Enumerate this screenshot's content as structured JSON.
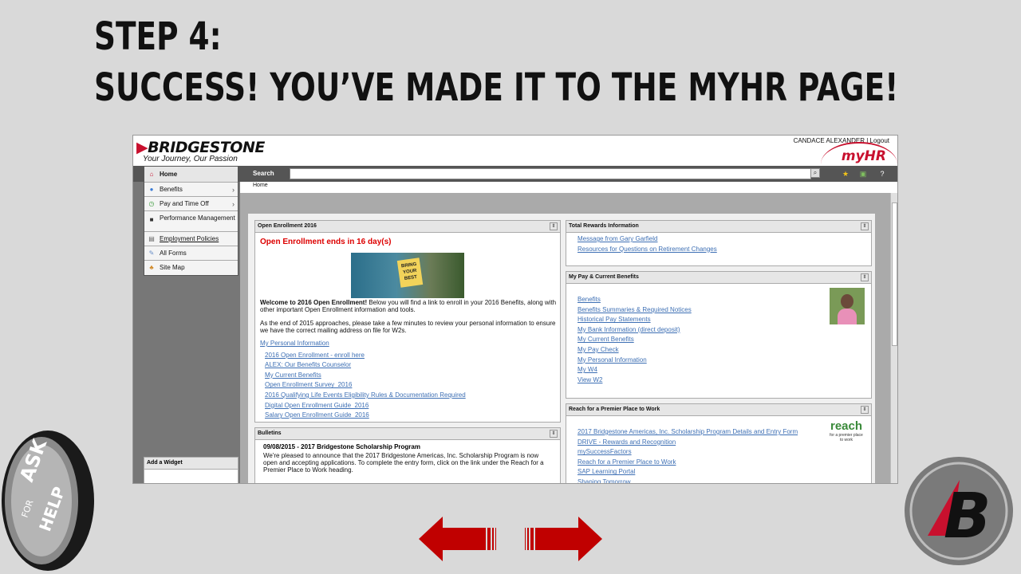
{
  "slide": {
    "title_line1": "STEP 4:",
    "title_line2": "SUCCESS! YOU’VE MADE IT TO THE MYHR PAGE!"
  },
  "header": {
    "logo_text": "BRIDGESTONE",
    "tagline": "Your Journey, Our Passion",
    "user_name": "CANDACE ALEXANDER",
    "separator": "|",
    "logout": "Logout",
    "myhr_logo": "myHR"
  },
  "search": {
    "label": "Search",
    "value": "",
    "button_icon": "magnifier-icon"
  },
  "breadcrumb": "Home",
  "sidebar": {
    "items": [
      {
        "label": "Home",
        "icon": "house-icon"
      },
      {
        "label": "Benefits",
        "icon": "globe-icon",
        "chevron": "›"
      },
      {
        "label": "Pay and Time Off",
        "icon": "clock-icon",
        "chevron": "›"
      },
      {
        "label": "Performance Management",
        "icon": "briefcase-icon"
      },
      {
        "label": "Employment Policies",
        "icon": "document-icon"
      },
      {
        "label": "All Forms",
        "icon": "form-icon"
      },
      {
        "label": "Site Map",
        "icon": "sitemap-icon"
      }
    ],
    "widget_label": "Add a Widget"
  },
  "open_enrollment": {
    "title": "Open Enrollment 2016",
    "alert": "Open Enrollment ends in 16 day(s)",
    "banner_text": "BRING YOUR BEST",
    "welcome_bold": "Welcome to 2016 Open Enrollment!",
    "welcome_rest": " Below you will find a link to enroll in your 2016 Benefits, along with other important Open Enrollment information and tools.",
    "para2": "As the end of 2015 approaches, please take a few minutes to review your personal information to ensure we have the correct mailing address on file for W2s.",
    "my_info_link": "My Personal Information",
    "links": [
      "2016 Open Enrollment - enroll here",
      "ALEX: Our Benefits Counselor",
      "My Current Benefits",
      "Open Enrollment Survey_2016",
      "2016 Qualifying Life Events Eligibility Rules & Documentation Required",
      "Digital Open Enrollment Guide_2016",
      "Salary Open Enrollment Guide_2016"
    ]
  },
  "bulletins": {
    "title": "Bulletins",
    "heading": "09/08/2015 - 2017 Bridgestone Scholarship Program",
    "text": "We're pleased to announce that the 2017 Bridgestone Americas, Inc. Scholarship Program is now open and accepting applications. To complete the entry form, click on the link under the Reach for a Premier Place to Work heading."
  },
  "total_rewards": {
    "title": "Total Rewards Information",
    "links": [
      "Message from Gary Garfield",
      "Resources for Questions on Retirement Changes"
    ]
  },
  "my_pay": {
    "title": "My Pay & Current Benefits",
    "links": [
      "Benefits",
      "Benefits Summaries & Required Notices",
      "Historical Pay Statements",
      "My Bank Information (direct deposit)",
      "My Current Benefits",
      "My Pay Check",
      "My Personal Information",
      "My W4",
      "View W2"
    ]
  },
  "reach": {
    "title": "Reach for a Premier Place to Work",
    "logo_big": "reach",
    "logo_small": "for a premier place to work",
    "links": [
      "2017 Bridgestone Americas, Inc. Scholarship Program Details and Entry Form",
      "DRIVE - Rewards and Recognition",
      "mySuccessFactors",
      "Reach for a Premier Place to Work",
      "SAP Learning Portal",
      "Shaping Tomorrow"
    ]
  },
  "decor": {
    "tire_text_1": "ASK",
    "tire_text_2": "FOR",
    "tire_text_3": "HELP",
    "badge_letter": "B"
  },
  "colors": {
    "brand_red": "#c8102e",
    "link_blue": "#3d6fb4",
    "arrow_red": "#c00000"
  }
}
